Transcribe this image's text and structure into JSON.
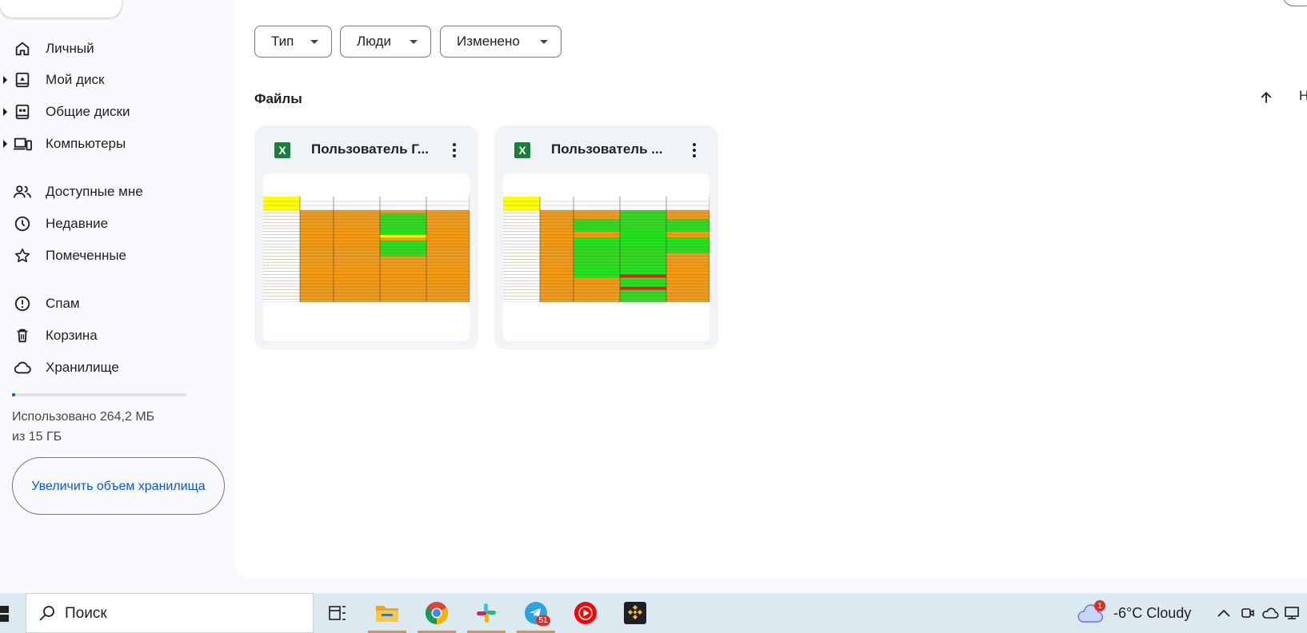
{
  "sidebar": {
    "items": [
      {
        "label": "Личный",
        "icon": "home-icon",
        "caret": false
      },
      {
        "label": "Мой диск",
        "icon": "my-drive-icon",
        "caret": true
      },
      {
        "label": "Общие диски",
        "icon": "shared-drives-icon",
        "caret": true
      },
      {
        "label": "Компьютеры",
        "icon": "computers-icon",
        "caret": true
      },
      {
        "label": "Доступные мне",
        "icon": "people-icon",
        "caret": false
      },
      {
        "label": "Недавние",
        "icon": "clock-icon",
        "caret": false
      },
      {
        "label": "Помеченные",
        "icon": "star-icon",
        "caret": false
      },
      {
        "label": "Спам",
        "icon": "spam-icon",
        "caret": false
      },
      {
        "label": "Корзина",
        "icon": "trash-icon",
        "caret": false
      },
      {
        "label": "Хранилище",
        "icon": "cloud-icon",
        "caret": false
      }
    ],
    "storage": {
      "used_line1": "Использовано 264,2 МБ",
      "used_line2": "из 15 ГБ",
      "used_fraction": 0.017
    },
    "upgrade_label": "Увеличить объем хранилища"
  },
  "filters": {
    "type_label": "Тип",
    "people_label": "Люди",
    "modified_label": "Изменено"
  },
  "files_section": {
    "title": "Файлы",
    "sort_cut_text": "Н"
  },
  "files": [
    {
      "title": "Пользователь Г...",
      "type_icon": "X"
    },
    {
      "title": "Пользователь ...",
      "type_icon": "X"
    }
  ],
  "taskbar": {
    "search_placeholder": "Поиск",
    "telegram_badge": "51",
    "weather_badge": "1",
    "weather_text": "-6°C  Cloudy"
  },
  "colors": {
    "accent": "#0b57d0",
    "sheet_orange": "#f39a16",
    "sheet_green": "#22e21e",
    "sheet_yellow": "#ffff00",
    "excel_green": "#188038"
  }
}
